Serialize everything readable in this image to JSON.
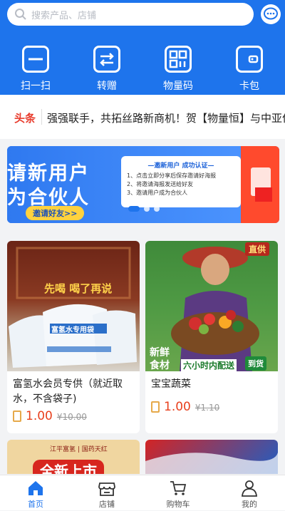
{
  "search": {
    "placeholder": "搜索产品、店铺"
  },
  "quick_actions": [
    {
      "label": "扫一扫",
      "icon": "scan-icon"
    },
    {
      "label": "转赠",
      "icon": "transfer-icon"
    },
    {
      "label": "物量码",
      "icon": "qrcode-icon"
    },
    {
      "label": "卡包",
      "icon": "wallet-icon"
    }
  ],
  "news": {
    "source": "头条",
    "text": "强强联手，共拓丝路新商机！贺【物量恒】与中亚伙"
  },
  "banner": {
    "line1": "请新用户",
    "line2": "为合伙人",
    "button": "邀请好友>>",
    "card_title": "—邀新用户 成功认证—",
    "steps": [
      "1、点击立即分享后保存邀请好海报",
      "2、将邀请海报发送给好友",
      "3、邀请用户成为合伙人"
    ]
  },
  "products": [
    {
      "name": "富氢水会员专供（就近取水，不含袋子)",
      "price": "1.00",
      "orig": "¥10.00",
      "img_text_top": "先喝 喝了再说",
      "img_text_bag": "富氢水专用袋"
    },
    {
      "name": "宝宝蔬菜",
      "price": "1.00",
      "orig": "¥1.10",
      "img_badge": "直供",
      "img_text_1": "新鲜",
      "img_text_2": "食材",
      "img_delivery": "六小时内配送",
      "img_arrive": "到货"
    }
  ],
  "peek": {
    "brand": "江平富氢 | 国药天红",
    "headline": "全新上市"
  },
  "tabs": [
    {
      "label": "首页",
      "icon": "home-icon",
      "active": true
    },
    {
      "label": "店铺",
      "icon": "store-icon",
      "active": false
    },
    {
      "label": "购物车",
      "icon": "cart-icon",
      "active": false
    },
    {
      "label": "我的",
      "icon": "user-icon",
      "active": false
    }
  ],
  "colors": {
    "primary": "#1e74ec",
    "price": "#e8401d"
  }
}
